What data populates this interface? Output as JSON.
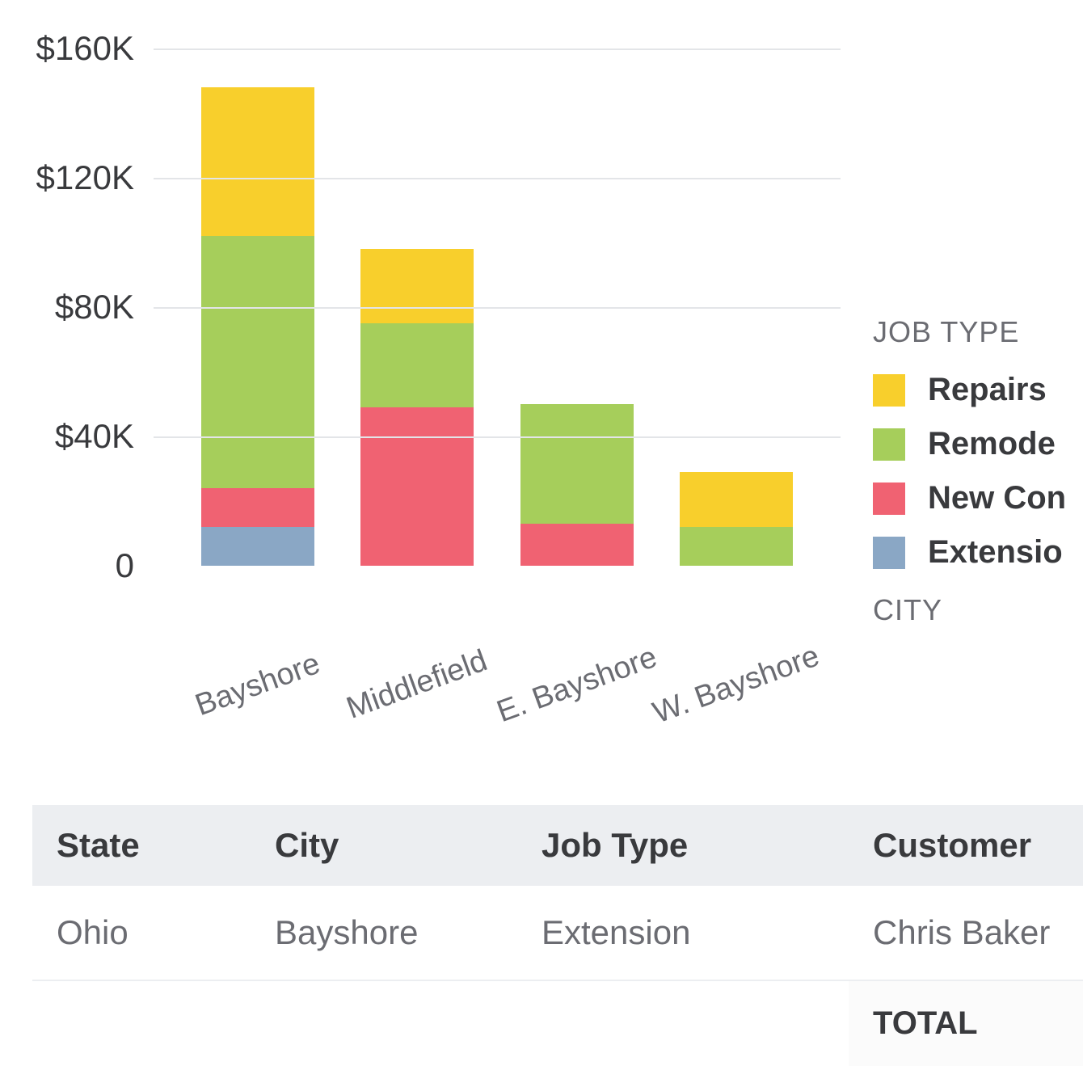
{
  "chart_data": {
    "type": "bar",
    "stacked": true,
    "categories": [
      "Bayshore",
      "Middlefield",
      "E. Bayshore",
      "W. Bayshore"
    ],
    "series": [
      {
        "name": "Extension",
        "color": "#8aa7c5",
        "values": [
          12000,
          0,
          0,
          0
        ]
      },
      {
        "name": "New Construction",
        "color": "#f06272",
        "values": [
          12000,
          49000,
          13000,
          0
        ]
      },
      {
        "name": "Remodel",
        "color": "#a6ce5b",
        "values": [
          78000,
          26000,
          37000,
          12000
        ]
      },
      {
        "name": "Repairs",
        "color": "#f8cf2c",
        "values": [
          46000,
          23000,
          0,
          17000
        ]
      }
    ],
    "ylim": [
      0,
      160000
    ],
    "y_ticks": [
      0,
      40000,
      80000,
      120000,
      160000
    ],
    "y_tick_labels": [
      "0",
      "$40K",
      "$80K",
      "$120K",
      "$160K"
    ],
    "legend_title": "JOB TYPE",
    "legend_items": [
      "Repairs",
      "Remodel",
      "New Construction",
      "Extension"
    ],
    "legend_subtitle": "CITY"
  },
  "colors": {
    "Repairs": "#f8cf2c",
    "Remodel": "#a6ce5b",
    "New Construction": "#f06272",
    "Extension": "#8aa7c5"
  },
  "table": {
    "headers": {
      "state": "State",
      "city": "City",
      "job_type": "Job Type",
      "customer": "Customer"
    },
    "rows": [
      {
        "state": "Ohio",
        "city": "Bayshore",
        "job_type": "Extension",
        "customer": "Chris Baker"
      }
    ],
    "footer_label": "TOTAL"
  }
}
